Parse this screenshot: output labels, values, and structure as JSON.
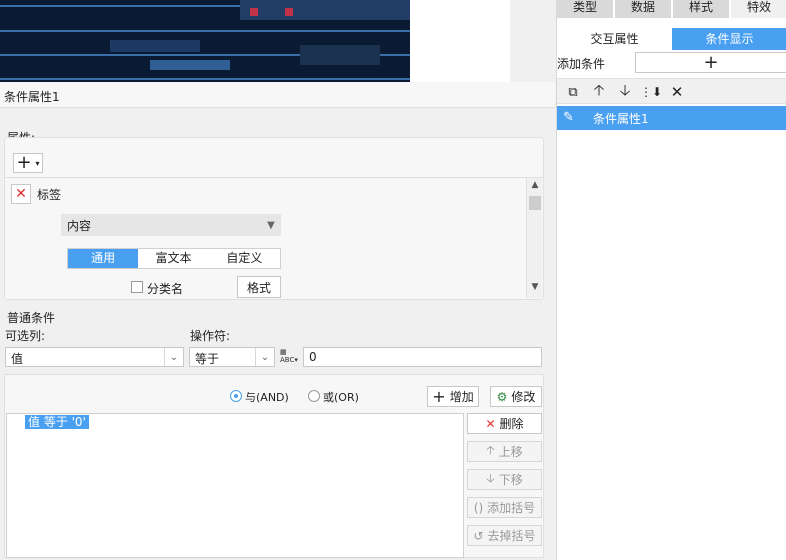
{
  "title": "条件属性1",
  "attributes": {
    "group_label": "属性:",
    "add_icon": "plus-icon",
    "item": {
      "label": "标签"
    },
    "content_select": "内容",
    "tabs": [
      "通用",
      "富文本",
      "自定义"
    ],
    "checkbox_label": "分类名",
    "format_button": "格式"
  },
  "condition": {
    "group_label": "普通条件",
    "col_label": "可选列:",
    "col_value": "值",
    "op_label": "操作符:",
    "op_value": "等于",
    "value": "0",
    "and_label": "与(AND)",
    "or_label": "或(OR)",
    "add_button": "增加",
    "modify_button": "修改",
    "list": [
      "值 等于 '0'"
    ],
    "delete_button": "删除",
    "up_button": "上移",
    "down_button": "下移",
    "add_paren_button": "添加括号",
    "remove_paren_button": "去掉括号"
  },
  "right_panel": {
    "tabs": [
      "类型",
      "数据",
      "样式",
      "特效"
    ],
    "subtabs": [
      "交互属性",
      "条件显示"
    ],
    "add_condition_label": "添加条件",
    "items": [
      "条件属性1"
    ]
  },
  "colors": {
    "accent": "#4aa0f0",
    "red": "#e0302e"
  }
}
